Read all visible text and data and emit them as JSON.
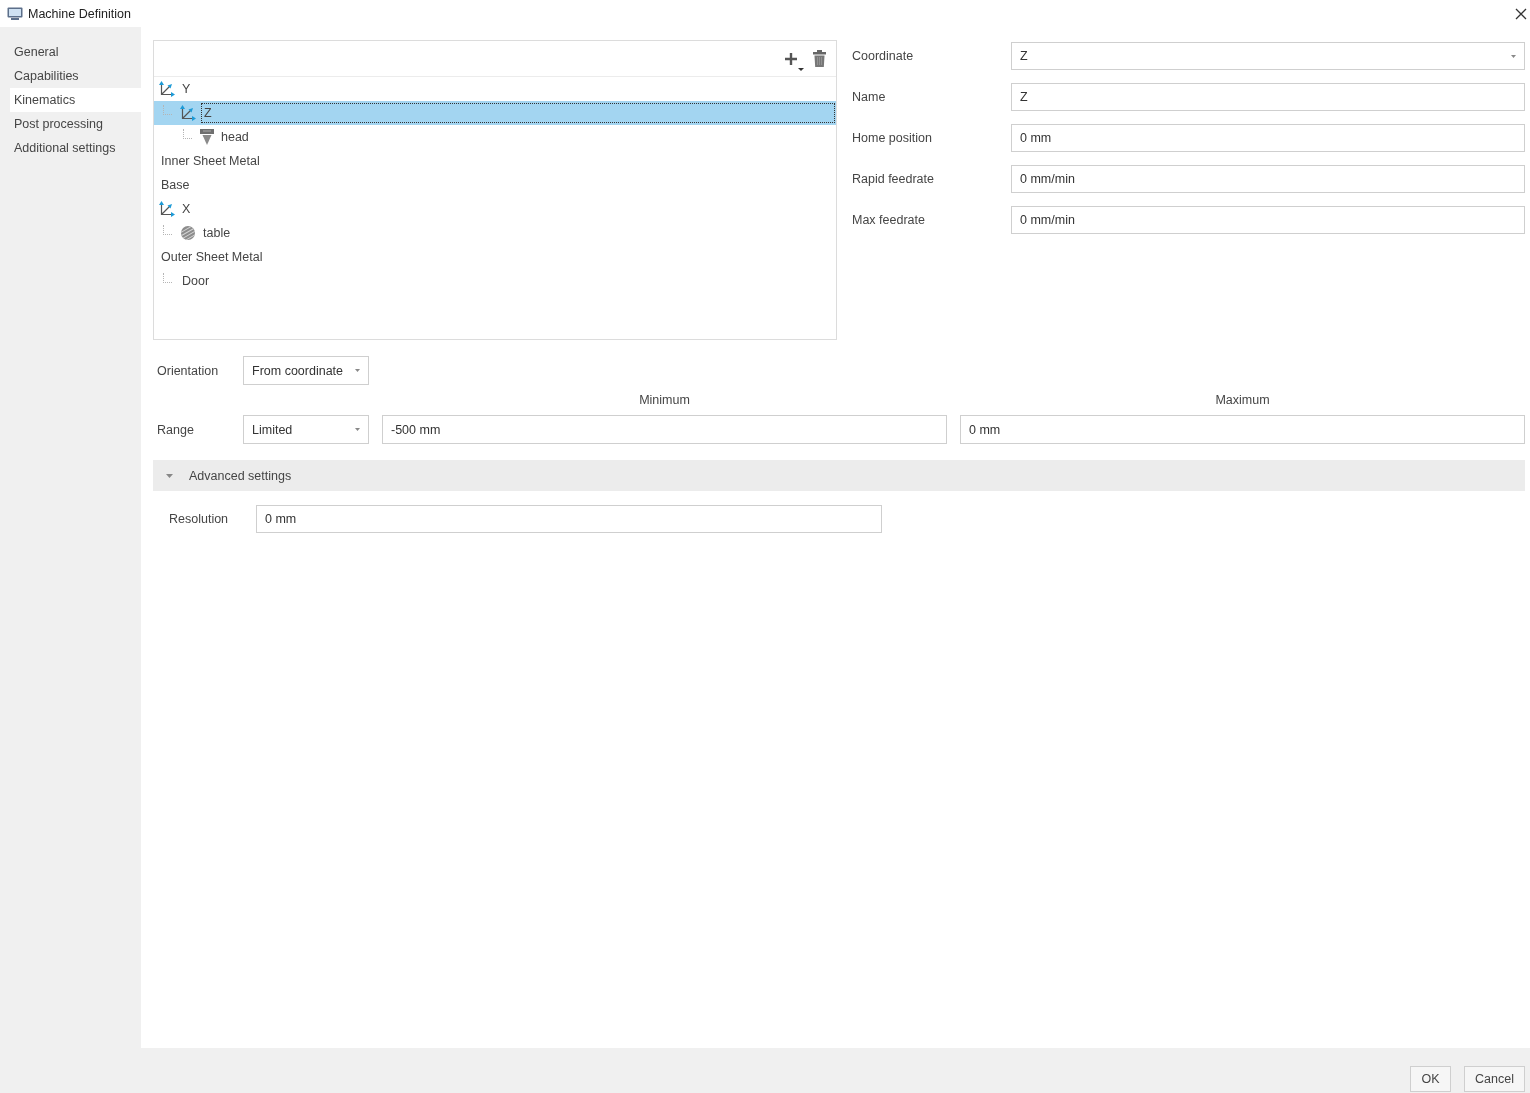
{
  "window": {
    "title": "Machine Definition"
  },
  "sidebar": {
    "items": [
      {
        "label": "General",
        "selected": false
      },
      {
        "label": "Capabilities",
        "selected": false
      },
      {
        "label": "Kinematics",
        "selected": true
      },
      {
        "label": "Post processing",
        "selected": false
      },
      {
        "label": "Additional settings",
        "selected": false
      }
    ]
  },
  "tree": {
    "items": [
      {
        "label": "Y",
        "kind": "axis",
        "selected": false,
        "children": [
          {
            "label": "Z",
            "kind": "axis",
            "selected": true,
            "children": [
              {
                "label": "head",
                "kind": "tool",
                "selected": false
              }
            ]
          }
        ]
      },
      {
        "label": "Inner Sheet Metal",
        "kind": "component",
        "selected": false
      },
      {
        "label": "Base",
        "kind": "component",
        "selected": false
      },
      {
        "label": "X",
        "kind": "axis",
        "selected": false,
        "children": [
          {
            "label": "table",
            "kind": "table",
            "selected": false
          }
        ]
      },
      {
        "label": "Outer Sheet Metal",
        "kind": "component",
        "selected": false,
        "children": [
          {
            "label": "Door",
            "kind": "component",
            "selected": false
          }
        ]
      }
    ]
  },
  "properties": {
    "fields": [
      {
        "label": "Coordinate",
        "value": "Z",
        "kind": "dropdown"
      },
      {
        "label": "Name",
        "value": "Z",
        "kind": "text"
      },
      {
        "label": "Home position",
        "value": "0 mm",
        "kind": "text"
      },
      {
        "label": "Rapid feedrate",
        "value": "0 mm/min",
        "kind": "text"
      },
      {
        "label": "Max feedrate",
        "value": "0 mm/min",
        "kind": "text"
      }
    ]
  },
  "orientation": {
    "label": "Orientation",
    "value": "From coordinate"
  },
  "range": {
    "label": "Range",
    "value": "Limited",
    "minimum": {
      "heading": "Minimum",
      "value": "-500 mm"
    },
    "maximum": {
      "heading": "Maximum",
      "value": "0 mm"
    }
  },
  "advanced_settings": {
    "title": "Advanced settings",
    "expanded": true,
    "fields": [
      {
        "label": "Resolution",
        "value": "0 mm"
      }
    ]
  },
  "buttons": [
    "OK",
    "Cancel"
  ]
}
